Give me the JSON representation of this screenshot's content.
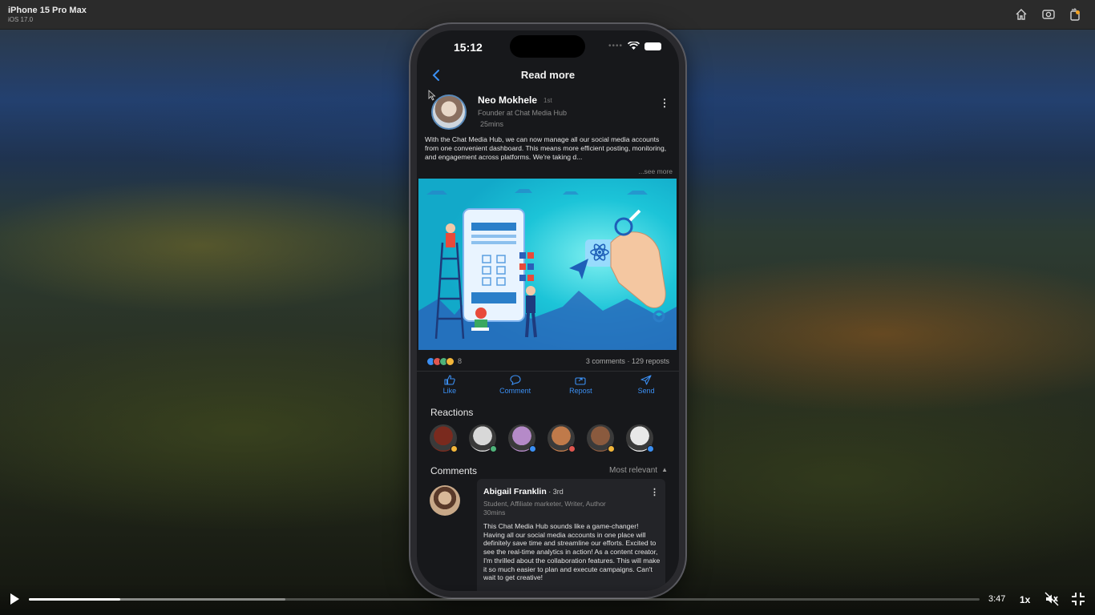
{
  "simulator": {
    "device": "iPhone 15 Pro Max",
    "os": "iOS 17.0",
    "icons": [
      "home-icon",
      "screenshot-icon",
      "rotate-icon"
    ]
  },
  "status_bar": {
    "time": "15:12",
    "icons": [
      "wifi-icon",
      "battery-icon"
    ]
  },
  "nav": {
    "title": "Read more",
    "back_icon": "chevron-left-icon"
  },
  "post": {
    "author": "Neo Mokhele",
    "degree": "1st",
    "headline": "Founder at Chat Media Hub",
    "time": "25mins",
    "text": "With the Chat Media Hub, we can now manage all our social media accounts from one convenient dashboard. This means more efficient posting, monitoring, and engagement across platforms. We're taking d...",
    "see_more": "...see more",
    "reaction_count": "8",
    "comments": "3 comments",
    "dot": "·",
    "reposts": "129 reposts"
  },
  "actions": [
    {
      "label": "Like",
      "icon": "thumbs-up-icon"
    },
    {
      "label": "Comment",
      "icon": "comment-icon"
    },
    {
      "label": "Repost",
      "icon": "repost-icon"
    },
    {
      "label": "Send",
      "icon": "send-icon"
    }
  ],
  "reactions": {
    "title": "Reactions",
    "people": [
      {
        "avatar": "#7a2a1e",
        "badge": "#f3b63a"
      },
      {
        "avatar": "#d8d8d8",
        "badge": "#4fb37a"
      },
      {
        "avatar": "#b58ac8",
        "badge": "#3b8ff3"
      },
      {
        "avatar": "#c07a4a",
        "badge": "#e0564f"
      },
      {
        "avatar": "#8a5a3e",
        "badge": "#f3b63a"
      },
      {
        "avatar": "#e8e8e8",
        "badge": "#3b8ff3"
      }
    ]
  },
  "comments": {
    "title": "Comments",
    "sort": "Most relevant",
    "items": [
      {
        "name": "Abigail Franklin",
        "degree": " · 3rd",
        "role": "Student, Affiliate marketer, Writer, Author",
        "time": "30mins",
        "text": "This Chat Media Hub sounds like a game-changer! Having all our social media accounts in one place will definitely save time and streamline our efforts. Excited to see the real-time analytics in action! As a content creator, I'm thrilled about the collaboration features. This will make it so much easier to plan and execute campaigns. Can't wait to get creative!"
      }
    ]
  },
  "player": {
    "time_remaining": "3:47",
    "speed": "1x",
    "progress_fraction": 0.096,
    "buffered_fraction": 0.27
  },
  "colors": {
    "accent": "#3b8ff3",
    "screen_bg": "#17181b",
    "card_bg": "#232428"
  }
}
